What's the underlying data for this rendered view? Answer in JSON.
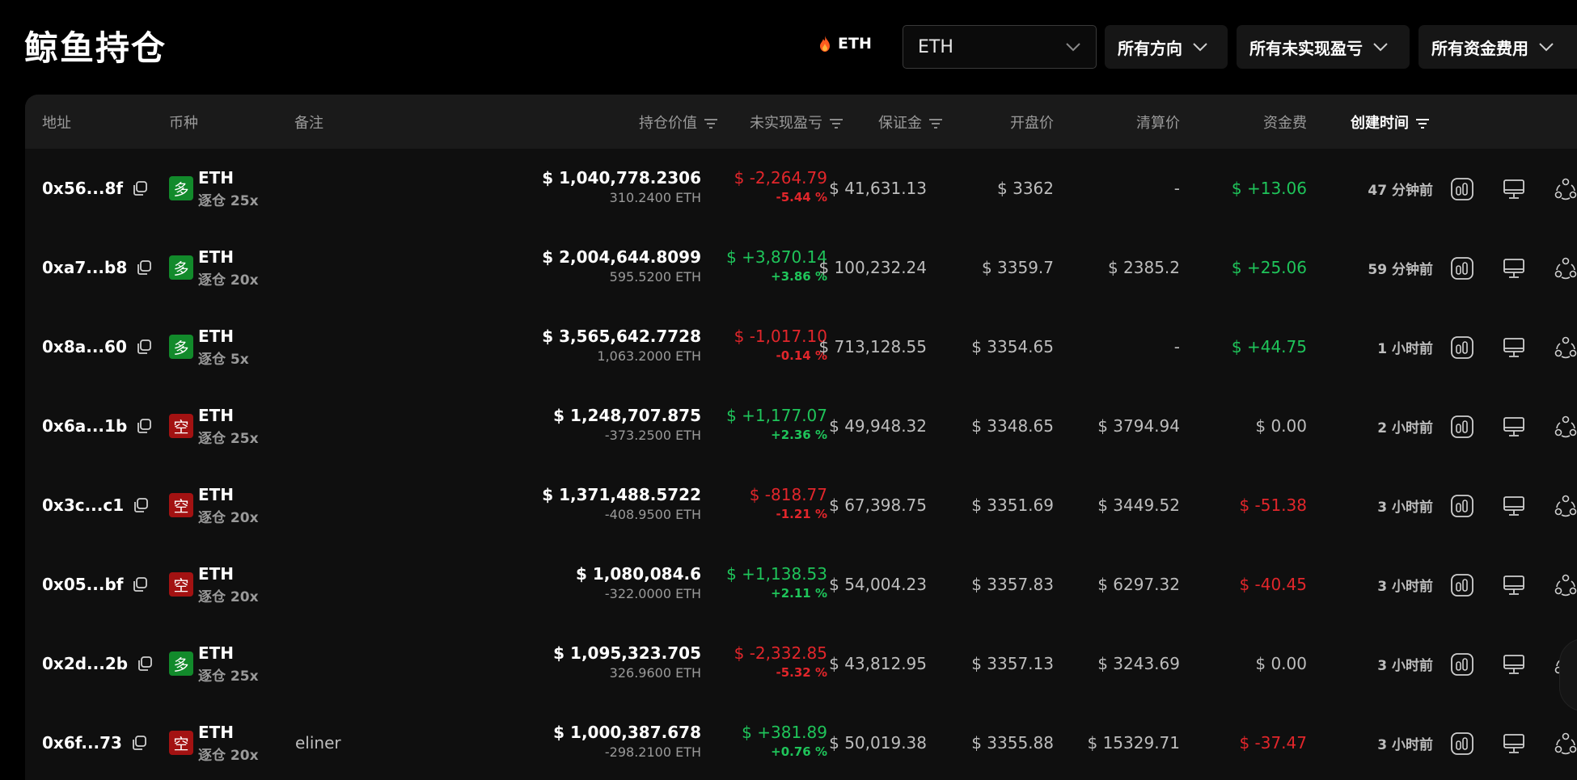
{
  "page": {
    "title": "鲸鱼持仓"
  },
  "toolbar": {
    "hot_coin": "ETH",
    "coin_select": "ETH",
    "direction_filter": "所有方向",
    "pnl_filter": "所有未实现盈亏",
    "funding_filter": "所有资金费用"
  },
  "table": {
    "headers": {
      "address": "地址",
      "coin": "币种",
      "note": "备注",
      "value": "持仓价值",
      "pnl": "未实现盈亏",
      "margin": "保证金",
      "entry": "开盘价",
      "liq": "清算价",
      "funding": "资金费",
      "created": "创建时间"
    },
    "rows": [
      {
        "address": "0x56...8f",
        "side": "多",
        "side_type": "long",
        "coin": "ETH",
        "lev": "逐仓 25x",
        "note": "",
        "value": "$ 1,040,778.2306",
        "size": "310.2400 ETH",
        "pnl": "$ -2,264.79",
        "pnl_pct": "-5.44 %",
        "pnl_sign": "neg",
        "margin": "$ 41,631.13",
        "entry": "$ 3362",
        "liq": "-",
        "funding": "$ +13.06",
        "funding_sign": "pos",
        "created": "47 分钟前"
      },
      {
        "address": "0xa7...b8",
        "side": "多",
        "side_type": "long",
        "coin": "ETH",
        "lev": "逐仓 20x",
        "note": "",
        "value": "$ 2,004,644.8099",
        "size": "595.5200 ETH",
        "pnl": "$ +3,870.14",
        "pnl_pct": "+3.86 %",
        "pnl_sign": "pos",
        "margin": "$ 100,232.24",
        "entry": "$ 3359.7",
        "liq": "$ 2385.2",
        "funding": "$ +25.06",
        "funding_sign": "pos",
        "created": "59 分钟前"
      },
      {
        "address": "0x8a...60",
        "side": "多",
        "side_type": "long",
        "coin": "ETH",
        "lev": "逐仓 5x",
        "note": "",
        "value": "$ 3,565,642.7728",
        "size": "1,063.2000 ETH",
        "pnl": "$ -1,017.10",
        "pnl_pct": "-0.14 %",
        "pnl_sign": "neg",
        "margin": "$ 713,128.55",
        "entry": "$ 3354.65",
        "liq": "-",
        "funding": "$ +44.75",
        "funding_sign": "pos",
        "created": "1 小时前"
      },
      {
        "address": "0x6a...1b",
        "side": "空",
        "side_type": "short",
        "coin": "ETH",
        "lev": "逐仓 25x",
        "note": "",
        "value": "$ 1,248,707.875",
        "size": "-373.2500 ETH",
        "pnl": "$ +1,177.07",
        "pnl_pct": "+2.36 %",
        "pnl_sign": "pos",
        "margin": "$ 49,948.32",
        "entry": "$ 3348.65",
        "liq": "$ 3794.94",
        "funding": "$ 0.00",
        "funding_sign": "neutral",
        "created": "2 小时前"
      },
      {
        "address": "0x3c...c1",
        "side": "空",
        "side_type": "short",
        "coin": "ETH",
        "lev": "逐仓 20x",
        "note": "",
        "value": "$ 1,371,488.5722",
        "size": "-408.9500 ETH",
        "pnl": "$ -818.77",
        "pnl_pct": "-1.21 %",
        "pnl_sign": "neg",
        "margin": "$ 67,398.75",
        "entry": "$ 3351.69",
        "liq": "$ 3449.52",
        "funding": "$ -51.38",
        "funding_sign": "neg",
        "created": "3 小时前"
      },
      {
        "address": "0x05...bf",
        "side": "空",
        "side_type": "short",
        "coin": "ETH",
        "lev": "逐仓 20x",
        "note": "",
        "value": "$ 1,080,084.6",
        "size": "-322.0000 ETH",
        "pnl": "$ +1,138.53",
        "pnl_pct": "+2.11 %",
        "pnl_sign": "pos",
        "margin": "$ 54,004.23",
        "entry": "$ 3357.83",
        "liq": "$ 6297.32",
        "funding": "$ -40.45",
        "funding_sign": "neg",
        "created": "3 小时前"
      },
      {
        "address": "0x2d...2b",
        "side": "多",
        "side_type": "long",
        "coin": "ETH",
        "lev": "逐仓 25x",
        "note": "",
        "value": "$ 1,095,323.705",
        "size": "326.9600 ETH",
        "pnl": "$ -2,332.85",
        "pnl_pct": "-5.32 %",
        "pnl_sign": "neg",
        "margin": "$ 43,812.95",
        "entry": "$ 3357.13",
        "liq": "$ 3243.69",
        "funding": "$ 0.00",
        "funding_sign": "neutral",
        "created": "3 小时前"
      },
      {
        "address": "0x6f...73",
        "side": "空",
        "side_type": "short",
        "coin": "ETH",
        "lev": "逐仓 20x",
        "note": "eliner",
        "value": "$ 1,000,387.678",
        "size": "-298.2100 ETH",
        "pnl": "$ +381.89",
        "pnl_pct": "+0.76 %",
        "pnl_sign": "pos",
        "margin": "$ 50,019.38",
        "entry": "$ 3355.88",
        "liq": "$ 15329.71",
        "funding": "$ -37.47",
        "funding_sign": "neg",
        "created": "3 小时前"
      }
    ]
  },
  "icons": {
    "row_actions": [
      "chart-icon",
      "monitor-icon",
      "share-icon"
    ],
    "copy": "copy-icon",
    "sort": "sort-icon",
    "flame": "flame-icon",
    "chevron": "chevron-down-icon"
  },
  "colors": {
    "positive": "#1fc45a",
    "negative": "#e1262b",
    "long_badge": "#128a2b",
    "short_badge": "#a31212"
  }
}
